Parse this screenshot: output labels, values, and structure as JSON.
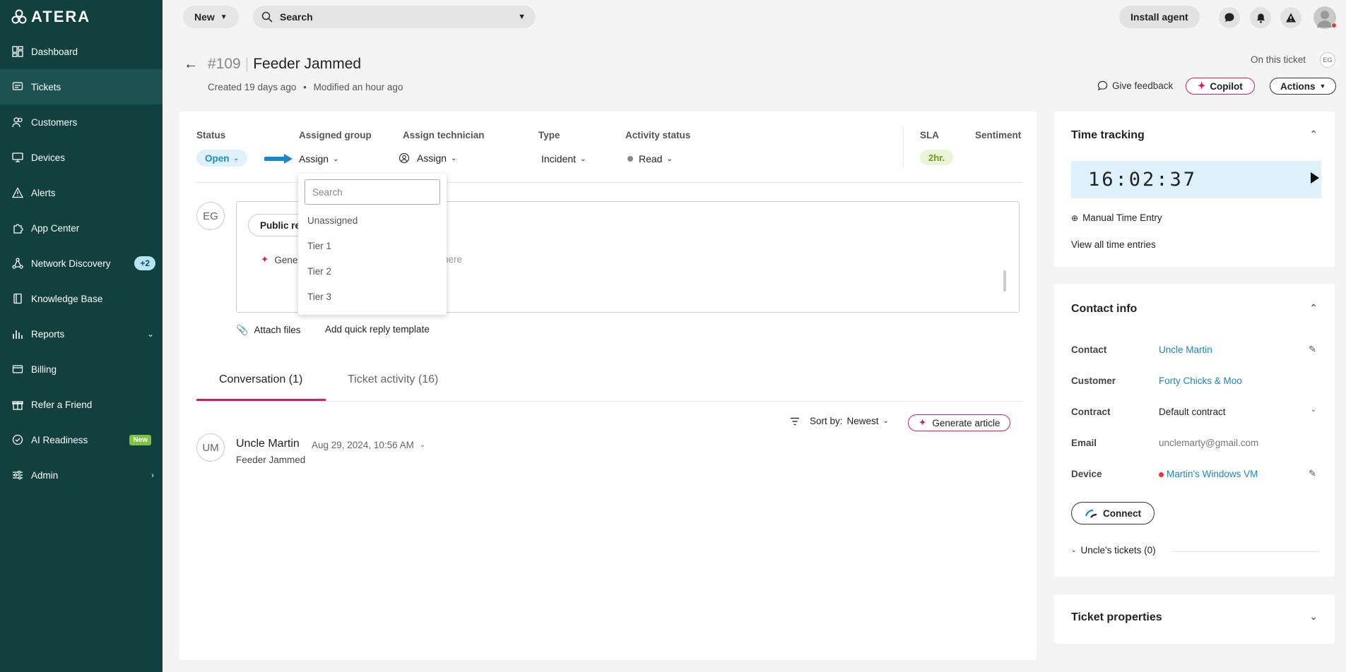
{
  "sidebar": {
    "logo": "ATERA",
    "items": [
      {
        "label": "Dashboard"
      },
      {
        "label": "Tickets"
      },
      {
        "label": "Customers"
      },
      {
        "label": "Devices"
      },
      {
        "label": "Alerts"
      },
      {
        "label": "App Center"
      },
      {
        "label": "Network Discovery",
        "badge": "+2"
      },
      {
        "label": "Knowledge Base"
      },
      {
        "label": "Reports"
      },
      {
        "label": "Billing"
      },
      {
        "label": "Refer a Friend"
      },
      {
        "label": "AI Readiness",
        "badge": "New"
      },
      {
        "label": "Admin"
      }
    ]
  },
  "topbar": {
    "new_label": "New",
    "search_label": "Search",
    "install_agent": "Install agent"
  },
  "ticket": {
    "number": "#109",
    "title": "Feeder Jammed",
    "created": "Created 19 days ago",
    "modified": "Modified an hour ago",
    "on_this_ticket": "On this ticket",
    "viewer_initials": "EG",
    "give_feedback": "Give feedback",
    "copilot": "Copilot",
    "actions": "Actions"
  },
  "fields": {
    "status_label": "Status",
    "status_value": "Open",
    "group_label": "Assigned group",
    "group_value": "Assign",
    "tech_label": "Assign technician",
    "tech_value": "Assign",
    "type_label": "Type",
    "type_value": "Incident",
    "activity_label": "Activity status",
    "activity_value": "Read",
    "sla_label": "SLA",
    "sla_value": "2hr.",
    "sentiment_label": "Sentiment"
  },
  "dropdown": {
    "search_placeholder": "Search",
    "options": [
      "Unassigned",
      "Tier 1",
      "Tier 2",
      "Tier 3"
    ]
  },
  "reply": {
    "author_initials": "EG",
    "public_reply": "Public re",
    "generate": "Gene",
    "placeholder_tail": "here",
    "attach_files": "Attach files",
    "quick_reply": "Add quick reply template"
  },
  "tabs": {
    "conversation": "Conversation (1)",
    "activity": "Ticket activity (16)"
  },
  "conversation": {
    "sort_label": "Sort by:",
    "sort_value": "Newest",
    "generate_article": "Generate article",
    "message": {
      "initials": "UM",
      "author": "Uncle Martin",
      "date": "Aug 29, 2024, 10:56 AM",
      "body": "Feeder Jammed"
    }
  },
  "time_tracking": {
    "title": "Time tracking",
    "timer": "16:02:37",
    "manual_entry": "Manual Time Entry",
    "view_all": "View all time entries"
  },
  "contact_info": {
    "title": "Contact info",
    "contact_label": "Contact",
    "contact_value": "Uncle Martin",
    "customer_label": "Customer",
    "customer_value": "Forty Chicks & Moo",
    "contract_label": "Contract",
    "contract_value": "Default contract",
    "email_label": "Email",
    "email_value": "unclemarty@gmail.com",
    "device_label": "Device",
    "device_value": "Martin's Windows VM",
    "connect": "Connect",
    "uncle_tickets": "Uncle's tickets (0)"
  },
  "ticket_properties": {
    "title": "Ticket properties"
  },
  "colors": {
    "sidebar_bg": "#11403e",
    "accent_pink": "#d21f63",
    "link_blue": "#1a86c2",
    "status_blue": "#1b8ec4",
    "sla_green": "#6b9a1f"
  }
}
